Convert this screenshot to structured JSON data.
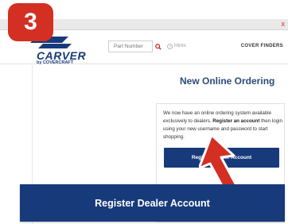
{
  "step": {
    "number": "3"
  },
  "browser": {
    "close_glyph": "x"
  },
  "brand": {
    "logo_text": "CARVER",
    "logo_subtext": "by COVERCRAFT",
    "logo_color": "#173a7a"
  },
  "header": {
    "search_placeholder": "Part Number",
    "search_icon": "search-icon",
    "hints_label": "Hints",
    "hints_icon": "help-icon",
    "cover_finders_label": "COVER FINDERS"
  },
  "main": {
    "title": "New Online Ordering",
    "info_text_1": "We now have an online ordering system available exclusively to dealers. ",
    "info_text_bold": "Register an account",
    "info_text_2": " then login using your new username and password to start shopping.",
    "register_button_label": "Register Dealer Account"
  },
  "callout": {
    "register_button_label": "Register Dealer Account"
  },
  "colors": {
    "accent_red": "#d42f23",
    "button_blue": "#173a7a"
  }
}
